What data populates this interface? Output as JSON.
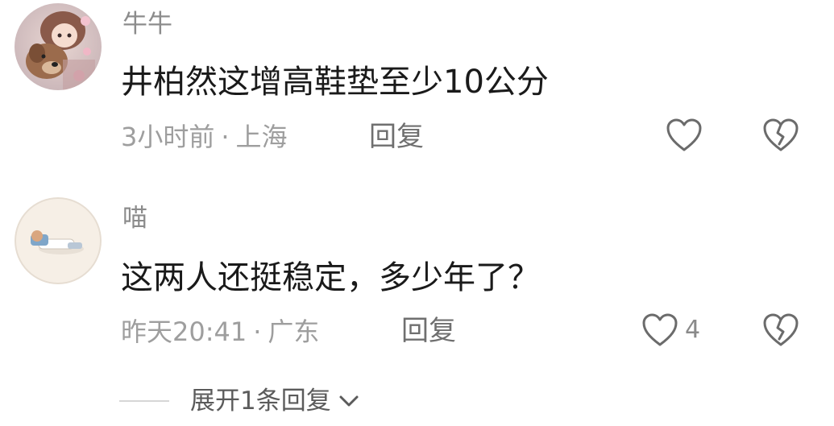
{
  "comments": [
    {
      "username": "牛牛",
      "text": "井柏然这增高鞋垫至少10公分",
      "time": "3小时前",
      "separator": "·",
      "location": "上海",
      "reply_label": "回复",
      "likes": "",
      "like_icon": "heart-outline-icon",
      "dislike_icon": "broken-heart-icon"
    },
    {
      "username": "喵",
      "text": "这两人还挺稳定，多少年了？",
      "time": "昨天20:41",
      "separator": "·",
      "location": "广东",
      "reply_label": "回复",
      "likes": "4",
      "like_icon": "heart-outline-icon",
      "dislike_icon": "broken-heart-icon"
    }
  ],
  "expand": {
    "label": "展开1条回复",
    "icon": "chevron-down-icon"
  },
  "colors": {
    "username": "#8c8c8c",
    "text": "#1a1a1a",
    "meta": "#9e9e9e",
    "icon": "#6b6b6b"
  }
}
